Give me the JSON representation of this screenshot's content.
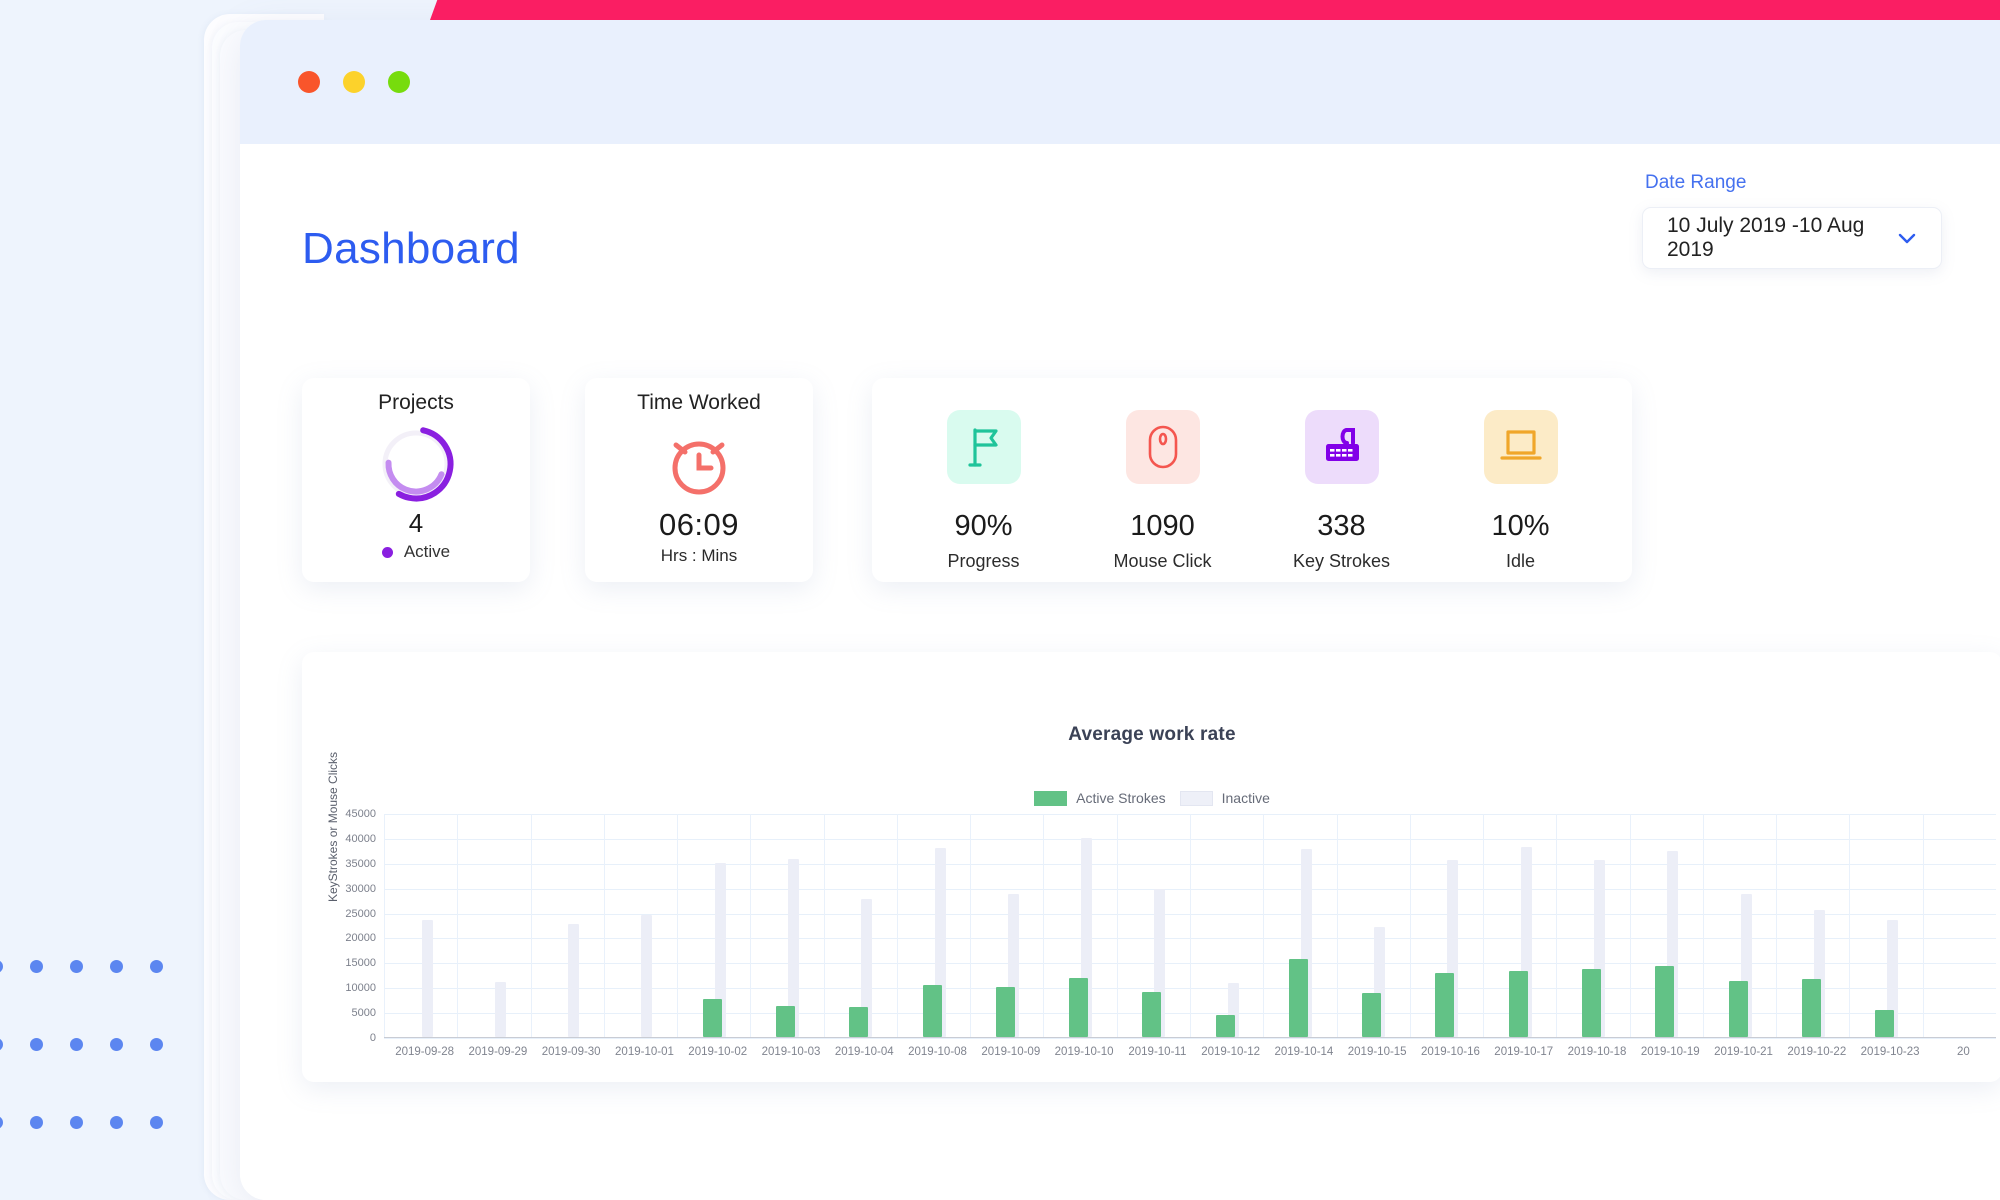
{
  "window": {
    "traffic_lights": [
      {
        "name": "close",
        "color": "#f9552b"
      },
      {
        "name": "minimize",
        "color": "#fcd22b"
      },
      {
        "name": "maximize",
        "color": "#77dc0d"
      }
    ],
    "ribbon_color": "#fa1e63"
  },
  "header": {
    "title": "Dashboard",
    "date_range": {
      "label": "Date Range",
      "value": "10 July 2019 -10 Aug 2019",
      "chevron_icon": "chevron-down-icon"
    }
  },
  "cards": {
    "projects": {
      "title": "Projects",
      "value": "4",
      "legend": "Active",
      "accent": "#8a1fe0",
      "accent_light": "#c48cf0",
      "track": "#f1eef7",
      "icon": "donut-chart-icon"
    },
    "time_worked": {
      "title": "Time Worked",
      "value": "06:09",
      "unit": "Hrs  : Mins",
      "accent": "#f4706a",
      "icon": "alarm-clock-icon"
    },
    "metrics": [
      {
        "icon": "flag-icon",
        "value": "90%",
        "label": "Progress",
        "color": "#1fc49a",
        "bg": "#d9fbef"
      },
      {
        "icon": "mouse-icon",
        "value": "1090",
        "label": "Mouse Click",
        "color": "#f4564f",
        "bg": "#fde6e2"
      },
      {
        "icon": "keyboard-icon",
        "value": "338",
        "label": "Key Strokes",
        "color": "#8200e8",
        "bg": "#eddcfb"
      },
      {
        "icon": "laptop-icon",
        "value": "10%",
        "label": "Idle",
        "color": "#f0a62a",
        "bg": "#fcebc7"
      }
    ]
  },
  "chart_data": {
    "type": "bar",
    "title": "Average work rate",
    "xlabel": "",
    "ylabel": "KeyStrokes or Mouse Clicks",
    "ylim": [
      0,
      45000
    ],
    "yticks": [
      0,
      5000,
      10000,
      15000,
      20000,
      25000,
      30000,
      35000,
      40000,
      45000
    ],
    "grid": true,
    "legend_position": "top-center",
    "categories": [
      "2019-09-28",
      "2019-09-29",
      "2019-09-30",
      "2019-10-01",
      "2019-10-02",
      "2019-10-03",
      "2019-10-04",
      "2019-10-08",
      "2019-10-09",
      "2019-10-10",
      "2019-10-11",
      "2019-10-12",
      "2019-10-14",
      "2019-10-15",
      "2019-10-16",
      "2019-10-17",
      "2019-10-18",
      "2019-10-19",
      "2019-10-21",
      "2019-10-22",
      "2019-10-23",
      "20"
    ],
    "series": [
      {
        "name": "Active Strokes",
        "color": "#62c286",
        "values": [
          0,
          0,
          0,
          0,
          7700,
          6300,
          6000,
          10400,
          10000,
          11900,
          9100,
          4400,
          15700,
          8900,
          12800,
          13200,
          13600,
          14300,
          11300,
          11700,
          5500,
          0
        ]
      },
      {
        "name": "Inactive",
        "color": "#eceef7",
        "values": [
          23500,
          11000,
          22800,
          24600,
          35000,
          35700,
          27700,
          38000,
          28800,
          39900,
          29700,
          10900,
          37700,
          22100,
          35600,
          38100,
          35500,
          37300,
          28700,
          25600,
          23500,
          0
        ]
      }
    ]
  }
}
